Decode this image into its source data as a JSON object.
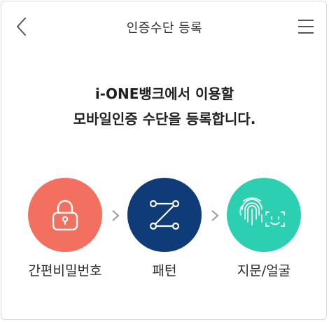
{
  "header": {
    "title": "인증수단 등록",
    "back_icon": "chevron-left-icon",
    "menu_icon": "hamburger-menu-icon"
  },
  "headline": {
    "line1": "i-ONE뱅크에서 이용할",
    "line2": "모바일인증 수단을 등록합니다."
  },
  "methods": [
    {
      "label": "간편비밀번호",
      "icon": "lock-icon",
      "color": "#f36f5f"
    },
    {
      "label": "패턴",
      "icon": "pattern-icon",
      "color": "#0f3b78"
    },
    {
      "label": "지문/얼굴",
      "icon": "fingerprint-face-icon",
      "color": "#2ccfb1"
    }
  ],
  "arrow_icon": "chevron-right-icon",
  "colors": {
    "text": "#222222",
    "arrow": "#9a9a9a"
  }
}
